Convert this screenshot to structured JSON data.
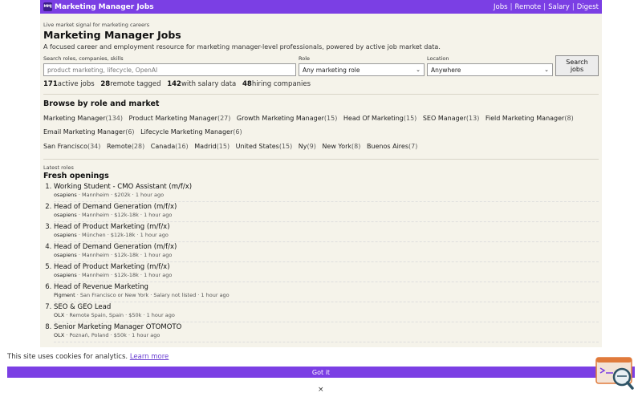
{
  "header": {
    "logo_text": "MMJ",
    "title": "Marketing Manager Jobs",
    "nav": [
      "Jobs",
      "Remote",
      "Salary",
      "Digest"
    ],
    "separator": "|"
  },
  "hero": {
    "tagline": "Live market signal for marketing careers",
    "title": "Marketing Manager Jobs",
    "description": "A focused career and employment resource for marketing manager-level professionals, powered by active job market data."
  },
  "search": {
    "query_label": "Search roles, companies, skills",
    "query_placeholder": "product marketing, lifecycle, OpenAI",
    "role_label": "Role",
    "role_value": "Any marketing role",
    "location_label": "Location",
    "location_value": "Anywhere",
    "button_label": "Search jobs"
  },
  "stats": [
    {
      "num": "171",
      "label": "active jobs"
    },
    {
      "num": "28",
      "label": "remote tagged"
    },
    {
      "num": "142",
      "label": "with salary data"
    },
    {
      "num": "48",
      "label": "hiring companies"
    }
  ],
  "browse": {
    "title": "Browse by role and market",
    "roles": [
      {
        "name": "Marketing Manager",
        "count": "(134)"
      },
      {
        "name": "Product Marketing Manager",
        "count": "(27)"
      },
      {
        "name": "Growth Marketing Manager",
        "count": "(15)"
      },
      {
        "name": "Head Of Marketing",
        "count": "(15)"
      },
      {
        "name": "SEO Manager",
        "count": "(13)"
      },
      {
        "name": "Field Marketing Manager",
        "count": "(8)"
      },
      {
        "name": "Email Marketing Manager",
        "count": "(6)"
      },
      {
        "name": "Lifecycle Marketing Manager",
        "count": "(6)"
      }
    ],
    "markets": [
      {
        "name": "San Francisco",
        "count": "(34)"
      },
      {
        "name": "Remote",
        "count": "(28)"
      },
      {
        "name": "Canada",
        "count": "(16)"
      },
      {
        "name": "Madrid",
        "count": "(15)"
      },
      {
        "name": "United States",
        "count": "(15)"
      },
      {
        "name": "Ny",
        "count": "(9)"
      },
      {
        "name": "New York",
        "count": "(8)"
      },
      {
        "name": "Buenos Aires",
        "count": "(7)"
      }
    ]
  },
  "latest": {
    "eyebrow": "Latest roles",
    "title": "Fresh openings",
    "jobs": [
      {
        "title": "Working Student - CMO Assistant (m/f/x)",
        "company": "osapiens",
        "location": "Mannheim",
        "salary": "$202k",
        "time": "1 hour ago"
      },
      {
        "title": "Head of Demand Generation (m/f/x)",
        "company": "osapiens",
        "location": "Mannheim",
        "salary": "$12k-18k",
        "time": "1 hour ago"
      },
      {
        "title": "Head of Product Marketing (m/f/x)",
        "company": "osapiens",
        "location": "München",
        "salary": "$12k-18k",
        "time": "1 hour ago"
      },
      {
        "title": "Head of Demand Generation (m/f/x)",
        "company": "osapiens",
        "location": "Mannheim",
        "salary": "$12k-18k",
        "time": "1 hour ago"
      },
      {
        "title": "Head of Product Marketing (m/f/x)",
        "company": "osapiens",
        "location": "Mannheim",
        "salary": "$12k-18k",
        "time": "1 hour ago"
      },
      {
        "title": "Head of Revenue Marketing",
        "company": "Pigment",
        "location": "San Francisco or New York",
        "salary": "Salary not listed",
        "time": "1 hour ago"
      },
      {
        "title": "SEO & GEO Lead",
        "company": "OLX",
        "location": "Remote Spain, Spain",
        "salary": "$50k",
        "time": "1 hour ago"
      },
      {
        "title": "Senior Marketing Manager OTOMOTO",
        "company": "OLX",
        "location": "Poznań, Poland",
        "salary": "$50k",
        "time": "1 hour ago"
      }
    ],
    "meta_separator": " · "
  },
  "cookie": {
    "text": "This site uses cookies for analytics.",
    "link": "Learn more",
    "button": "Got it",
    "close": "×"
  },
  "colors": {
    "accent": "#7b3fe4",
    "page_bg": "#f5f3ea"
  }
}
